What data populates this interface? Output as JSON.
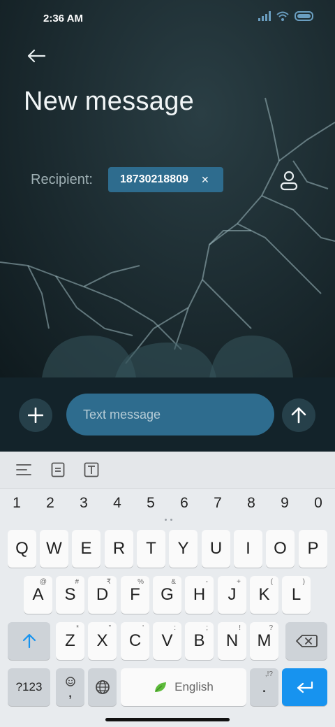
{
  "status": {
    "time": "2:36 AM"
  },
  "header": {
    "title": "New message"
  },
  "recipient": {
    "label": "Recipient:",
    "number": "18730218809",
    "remove_symbol": "×"
  },
  "compose": {
    "placeholder": "Text message"
  },
  "keyboard": {
    "numbers": [
      "1",
      "2",
      "3",
      "4",
      "5",
      "6",
      "7",
      "8",
      "9",
      "0"
    ],
    "row1": [
      "Q",
      "W",
      "E",
      "R",
      "T",
      "Y",
      "U",
      "I",
      "O",
      "P"
    ],
    "row2": [
      {
        "label": "A",
        "hint": "@"
      },
      {
        "label": "S",
        "hint": "#"
      },
      {
        "label": "D",
        "hint": "₹"
      },
      {
        "label": "F",
        "hint": "%"
      },
      {
        "label": "G",
        "hint": "&"
      },
      {
        "label": "H",
        "hint": "-"
      },
      {
        "label": "J",
        "hint": "+"
      },
      {
        "label": "K",
        "hint": "("
      },
      {
        "label": "L",
        "hint": ")"
      }
    ],
    "row3": [
      {
        "label": "Z",
        "hint": "*"
      },
      {
        "label": "X",
        "hint": "\""
      },
      {
        "label": "C",
        "hint": "'"
      },
      {
        "label": "V",
        "hint": ":"
      },
      {
        "label": "B",
        "hint": ";"
      },
      {
        "label": "N",
        "hint": "!"
      },
      {
        "label": "M",
        "hint": "?"
      }
    ],
    "symbols_key": "?123",
    "comma_key": ",",
    "space_label": "English",
    "period_key": ".",
    "period_hint": ",!?"
  },
  "colors": {
    "accent": "#2e6c8e",
    "enter": "#1793ef",
    "compose_bg": "#13232a"
  }
}
